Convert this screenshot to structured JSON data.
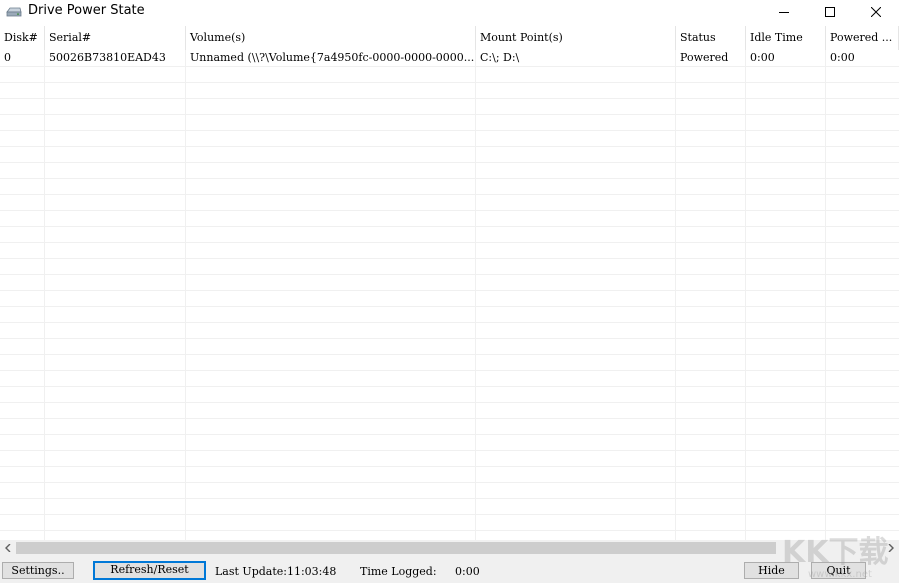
{
  "window": {
    "title": "Drive Power State",
    "icon": "drive-icon",
    "controls": [
      "minimize-icon",
      "maximize-icon",
      "close-icon"
    ]
  },
  "table": {
    "columns": [
      "Disk#",
      "Serial#",
      "Volume(s)",
      "Mount Point(s)",
      "Status",
      "Idle Time",
      "Powered ..."
    ],
    "rows": [
      [
        "0",
        "50026B73810EAD43",
        "Unnamed (\\\\?\\Volume{7a4950fc-0000-0000-0000...",
        "C:\\; D:\\",
        "Powered",
        "0:00",
        "0:00"
      ]
    ]
  },
  "footer": {
    "settings_label": "Settings..",
    "refresh_label": "Refresh/Reset",
    "last_update_label": "Last Update:11:03:48",
    "time_logged_label": "Time Logged:",
    "time_logged_value": "0:00",
    "hide_label": "Hide",
    "quit_label": "Quit"
  },
  "watermark": {
    "text": "KK下载",
    "url": "www.kkx.net"
  },
  "colors": {
    "focus_border": "#0078d7",
    "footer_bg": "#f0f0f0",
    "button_bg": "#e1e1e1"
  }
}
